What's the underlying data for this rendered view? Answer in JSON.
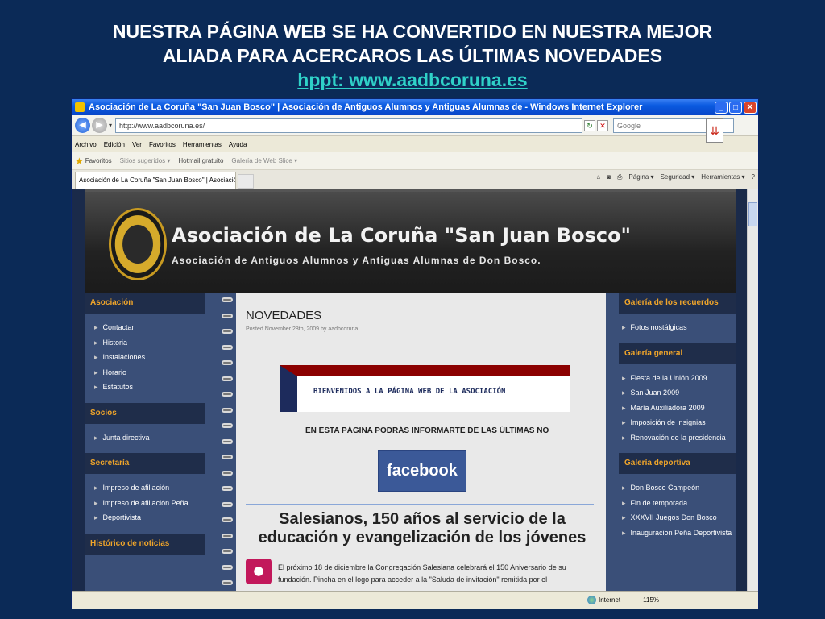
{
  "slide": {
    "title_line1": "NUESTRA PÁGINA WEB SE HA CONVERTIDO EN NUESTRA MEJOR",
    "title_line2": "ALIADA PARA ACERCAROS LAS ÚLTIMAS NOVEDADES",
    "link": "hppt: www.aadbcoruna.es"
  },
  "browser": {
    "window_title": "Asociación de La Coruña \"San Juan Bosco\" | Asociación de Antiguos Alumnos y Antiguas Alumnas de - Windows Internet Explorer",
    "address": "http://www.aadbcoruna.es/",
    "search_placeholder": "Google",
    "menu": [
      "Archivo",
      "Edición",
      "Ver",
      "Favoritos",
      "Herramientas",
      "Ayuda"
    ],
    "favorites": {
      "label": "Favoritos",
      "items": [
        "Sitios sugeridos ▾",
        "Hotmail gratuito",
        "Galería de Web Slice ▾"
      ]
    },
    "tab_title": "Asociación de La Coruña \"San Juan Bosco\" | Asociació...",
    "tools": [
      "Página ▾",
      "Seguridad ▾",
      "Herramientas ▾"
    ],
    "status": {
      "zone": "Internet",
      "zoom": "115%"
    }
  },
  "site": {
    "title": "Asociación de La Coruña \"San Juan Bosco\"",
    "subtitle": "Asociación de Antiguos Alumnos y Antiguas Alumnas de Don Bosco.",
    "left_sections": [
      {
        "heading": "Asociación",
        "items": [
          "Contactar",
          "Historia",
          "Instalaciones",
          "Horario",
          "Estatutos"
        ]
      },
      {
        "heading": "Socios",
        "items": [
          "Junta directiva"
        ]
      },
      {
        "heading": "Secretaría",
        "items": [
          "Impreso de afiliación",
          "Impreso de afiliación Peña",
          "Deportivista"
        ]
      },
      {
        "heading": "Histórico de noticias",
        "items": []
      }
    ],
    "right_sections": [
      {
        "heading": "Galería de los recuerdos",
        "items": [
          "Fotos nostálgicas"
        ]
      },
      {
        "heading": "Galería general",
        "items": [
          "Fiesta de la Unión 2009",
          "San Juan 2009",
          "María Auxiliadora 2009",
          "Imposición de insignias",
          "Renovación de la presidencia"
        ]
      },
      {
        "heading": "Galería deportiva",
        "items": [
          "Don Bosco Campeón",
          "Fin de temporada",
          "XXXVII Juegos Don Bosco",
          "Inauguracion Peña Deportivista"
        ]
      }
    ],
    "post": {
      "title": "NOVEDADES",
      "meta": "Posted November 28th, 2009 by aadbcoruna",
      "banner_text": "BIENVENIDOS A LA PÁGINA WEB DE LA ASOCIACIÓN",
      "info_line": "EN ESTA PÁGINA PODRÁS INFORMARTE DE LAS ÚLTIMAS NO",
      "facebook": "facebook",
      "headline_line1": "Salesianos, 150 años al servicio de la",
      "headline_line2": "educación y  evangelización de los jóvenes",
      "body": "El próximo 18 de diciembre la Congregación Salesiana celebrará el 150 Aniversario de su fundación. Pincha en el logo para acceder a la \"Saluda de invitación\" remitida por el"
    }
  }
}
